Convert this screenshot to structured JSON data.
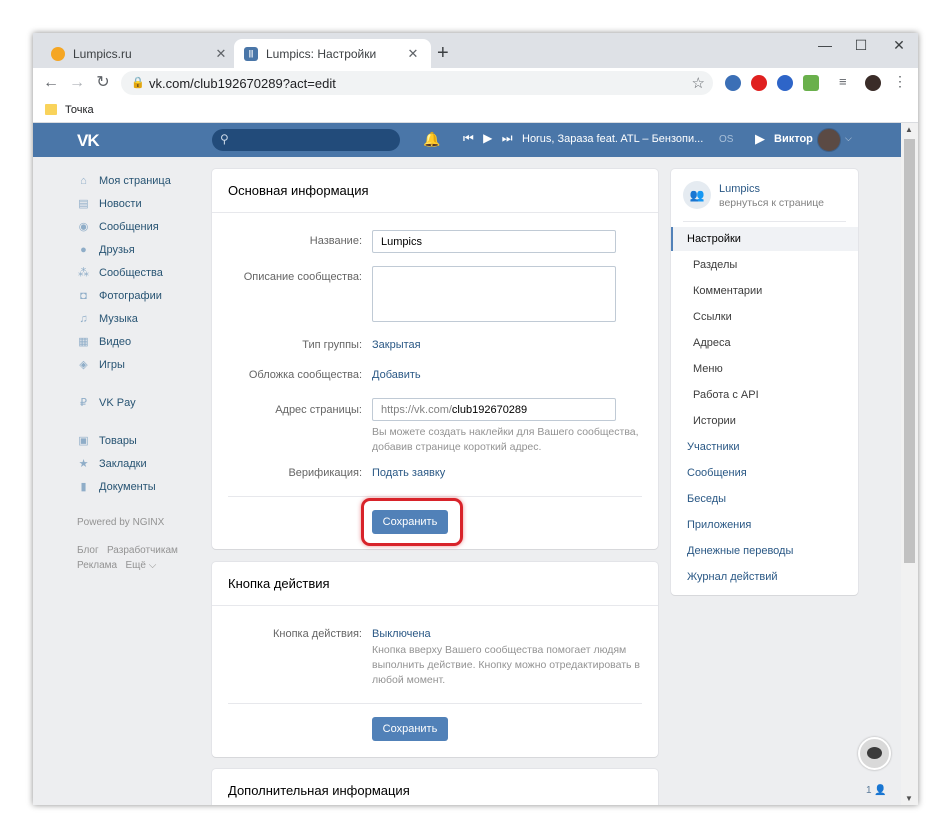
{
  "browser": {
    "tabs": [
      {
        "title": "Lumpics.ru",
        "active": false
      },
      {
        "title": "Lumpics: Настройки",
        "active": true
      }
    ],
    "tab_close": "✕",
    "new_tab": "+",
    "controls": {
      "minimize": "—",
      "maximize": "☐",
      "close": "✕"
    },
    "url": "vk.com/club192670289?act=edit",
    "bookmark": "Точка"
  },
  "vk_header": {
    "logo": "VK",
    "track": "Horus, Зараза feat. ATL – Бензопи...",
    "player_os": "OS",
    "user_name": "Виктор"
  },
  "left_nav": {
    "items": [
      {
        "label": "Моя страница",
        "icon": "home-icon",
        "glyph": "⌂"
      },
      {
        "label": "Новости",
        "icon": "news-icon",
        "glyph": "▤"
      },
      {
        "label": "Сообщения",
        "icon": "messages-icon",
        "glyph": "◉"
      },
      {
        "label": "Друзья",
        "icon": "friends-icon",
        "glyph": "●"
      },
      {
        "label": "Сообщества",
        "icon": "groups-icon",
        "glyph": "⁂"
      },
      {
        "label": "Фотографии",
        "icon": "photo-icon",
        "glyph": "◘"
      },
      {
        "label": "Музыка",
        "icon": "music-icon",
        "glyph": "♫"
      },
      {
        "label": "Видео",
        "icon": "video-icon",
        "glyph": "▦"
      },
      {
        "label": "Игры",
        "icon": "games-icon",
        "glyph": "◈"
      },
      {
        "label": "VK Pay",
        "icon": "vkpay-icon",
        "glyph": "₽"
      },
      {
        "label": "Товары",
        "icon": "goods-icon",
        "glyph": "▣"
      },
      {
        "label": "Закладки",
        "icon": "bookmarks-icon",
        "glyph": "★"
      },
      {
        "label": "Документы",
        "icon": "documents-icon",
        "glyph": "▮"
      }
    ],
    "powered": "Powered by NGINX",
    "footer_links": [
      "Блог",
      "Разработчикам",
      "Реклама",
      "Ещё ⌵"
    ]
  },
  "main_info": {
    "title": "Основная информация",
    "name_label": "Название:",
    "name_value": "Lumpics",
    "description_label": "Описание сообщества:",
    "group_type_label": "Тип группы:",
    "group_type_value": "Закрытая",
    "cover_label": "Обложка сообщества:",
    "cover_action": "Добавить",
    "address_label": "Адрес страницы:",
    "address_prefix": "https://vk.com/",
    "address_value": "club192670289",
    "address_hint": "Вы можете создать наклейки для Вашего сообщества, добавив странице короткий адрес.",
    "verification_label": "Верификация:",
    "verification_action": "Подать заявку",
    "save": "Сохранить"
  },
  "action_button": {
    "title": "Кнопка действия",
    "label": "Кнопка действия:",
    "value": "Выключена",
    "hint": "Кнопка вверху Вашего сообщества помогает людям выполнить действие. Кнопку можно отредактировать в любой момент.",
    "save": "Сохранить"
  },
  "extra_info": {
    "title": "Дополнительная информация"
  },
  "right_menu": {
    "club_name": "Lumpics",
    "back_link": "вернуться к странице",
    "items": [
      {
        "label": "Настройки",
        "active": true,
        "sub": false
      },
      {
        "label": "Разделы",
        "active": false,
        "sub": true
      },
      {
        "label": "Комментарии",
        "active": false,
        "sub": true
      },
      {
        "label": "Ссылки",
        "active": false,
        "sub": true
      },
      {
        "label": "Адреса",
        "active": false,
        "sub": true
      },
      {
        "label": "Меню",
        "active": false,
        "sub": true
      },
      {
        "label": "Работа с API",
        "active": false,
        "sub": true
      },
      {
        "label": "Истории",
        "active": false,
        "sub": true
      },
      {
        "label": "Участники",
        "active": false,
        "sub": false
      },
      {
        "label": "Сообщения",
        "active": false,
        "sub": false
      },
      {
        "label": "Беседы",
        "active": false,
        "sub": false
      },
      {
        "label": "Приложения",
        "active": false,
        "sub": false
      },
      {
        "label": "Денежные переводы",
        "active": false,
        "sub": false
      },
      {
        "label": "Журнал действий",
        "active": false,
        "sub": false
      }
    ]
  },
  "chat_widget": {
    "count": "1 👤"
  },
  "colors": {
    "vk_blue": "#4a76a8",
    "button_blue": "#5181b8",
    "link": "#2a5885",
    "highlight_red": "#d8232a"
  }
}
